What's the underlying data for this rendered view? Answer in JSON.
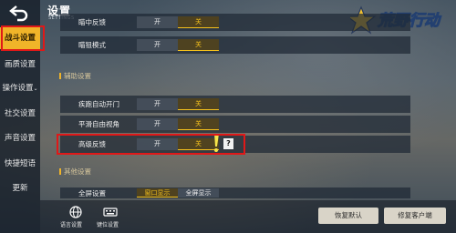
{
  "header": {
    "title": "设置",
    "subtitle": "SETTINGS"
  },
  "sidebar": {
    "items": [
      {
        "label": "战斗设置",
        "active": true
      },
      {
        "label": "画质设置"
      },
      {
        "label": "操作设置"
      },
      {
        "label": "社交设置"
      },
      {
        "label": "声音设置"
      },
      {
        "label": "快捷短语"
      },
      {
        "label": "更新"
      }
    ]
  },
  "settings": {
    "row_partial": {
      "label": "瞄中反馈",
      "on": "开",
      "off": "关"
    },
    "aim_mode": {
      "label": "瞄狙模式",
      "on": "开",
      "off": "关"
    },
    "section_assist": "辅助设置",
    "sprint_door": {
      "label": "疾跑自动开门",
      "on": "开",
      "off": "关"
    },
    "free_view": {
      "label": "平滑自由视角",
      "on": "开",
      "off": "关"
    },
    "advanced_feedback": {
      "label": "高级反馈",
      "on": "开",
      "off": "关",
      "help": "?"
    },
    "section_other": "其他设置",
    "fullscreen": {
      "label": "全屏设置",
      "opt1": "窗口显示",
      "opt2": "全屏显示"
    }
  },
  "bottom": {
    "language": "语言设置",
    "keybind": "键位设置",
    "restore_default": "恢复默认",
    "repair_client": "修复客户端"
  },
  "colors": {
    "accent": "#f0b429",
    "highlight_red": "#e01818"
  },
  "icons": [
    "back-arrow-icon",
    "globe-icon",
    "keyboard-icon",
    "help-icon",
    "game-logo-icon"
  ]
}
